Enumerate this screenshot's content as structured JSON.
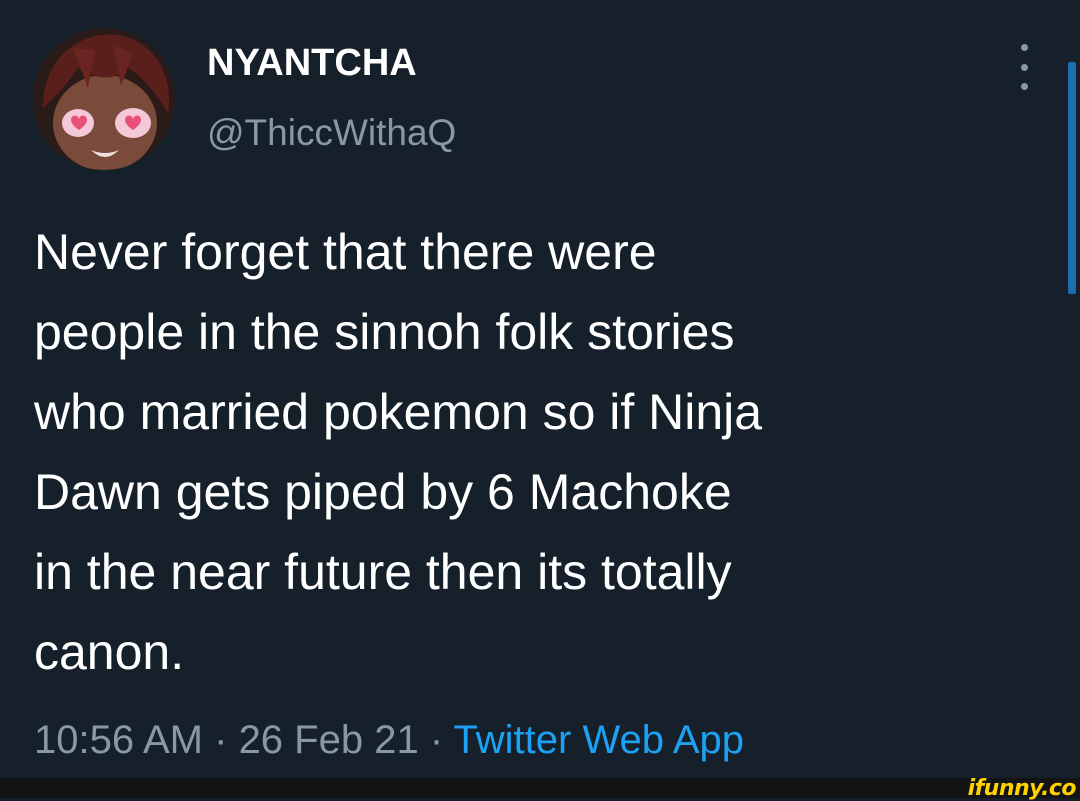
{
  "user": {
    "display_name": "NYANTCHA",
    "handle": "@ThiccWithaQ",
    "avatar_icon": "anime-avatar"
  },
  "tweet": {
    "lines": [
      "Never forget that there were",
      "people in the sinnoh folk stories",
      "who married pokemon so if Ninja",
      "Dawn gets piped by 6 Machoke",
      "in the near future then its totally",
      "canon."
    ]
  },
  "meta": {
    "time": "10:56 AM",
    "separator": " · ",
    "date": "26 Feb 21",
    "source": "Twitter Web App"
  },
  "menu": {
    "icon": "more-vertical-icon"
  },
  "watermark": {
    "text": "ifunny.co"
  },
  "colors": {
    "background": "#15202b",
    "secondary_text": "#8899a6",
    "link": "#1da1f2",
    "watermark": "#ffd200"
  }
}
